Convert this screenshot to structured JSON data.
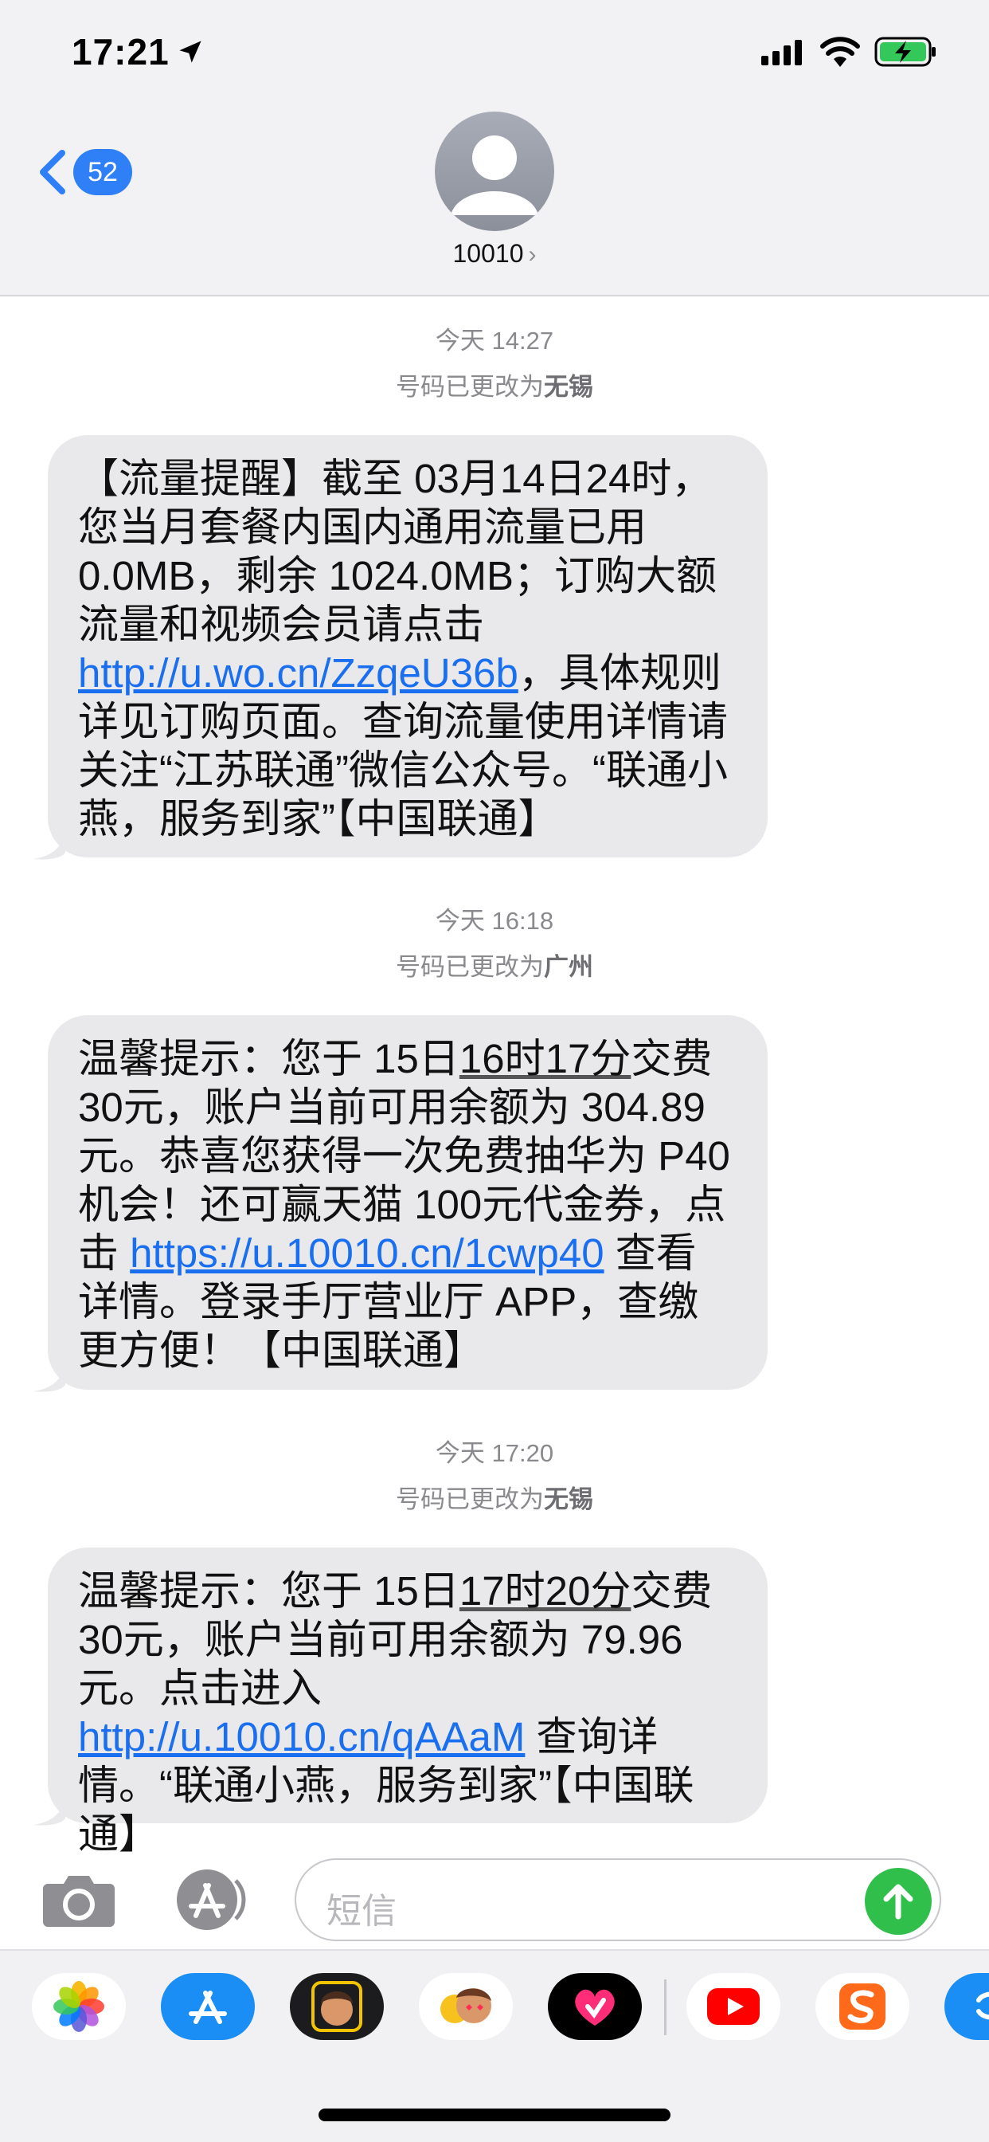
{
  "status_bar": {
    "time": "17:21"
  },
  "header": {
    "back_count": "52",
    "contact_name": "10010",
    "contact_chevron": "›"
  },
  "conversation": [
    {
      "timestamp": "今天 14:27",
      "notice_prefix": "号码已更改为",
      "notice_place": "无锡",
      "message": {
        "t1": "【流量提醒】截至 03月14日24时，您当月套餐内国内通用流量已用 0.0MB，剩余 1024.0MB；订购大额流量和视频会员请点击 ",
        "link": "http://u.wo.cn/ZzqeU36b",
        "t2": "，具体规则详见订购页面。查询流量使用详情请关注“江苏联通”微信公众号。“联通小燕，服务到家”【中国联通】"
      }
    },
    {
      "timestamp": "今天 16:18",
      "notice_prefix": "号码已更改为",
      "notice_place": "广州",
      "message": {
        "t1": "温馨提示：您于 15日",
        "t_ul": "16时17分",
        "t2": "交费 30元，账户当前可用余额为 304.89元。恭喜您获得一次免费抽华为 P40机会！还可赢天猫 100元代金券，点击 ",
        "link": "https://u.10010.cn/1cwp40",
        "t3": " 查看详情。登录手厅营业厅 APP，查缴更方便！【中国联通】"
      }
    },
    {
      "timestamp": "今天 17:20",
      "notice_prefix": "号码已更改为",
      "notice_place": "无锡",
      "message": {
        "t1": "温馨提示：您于 15日",
        "t_ul": "17时20分",
        "t2": "交费 30元，账户当前可用余额为 79.96元。点击进入 ",
        "link": "http://u.10010.cn/qAAaM",
        "t3": " 查询详情。“联通小燕，服务到家”【中国联通】"
      }
    }
  ],
  "composer": {
    "placeholder": "短信"
  },
  "colors": {
    "link": "#1a6ff0",
    "bubble": "#e9e9eb",
    "accent": "#2f7ff6",
    "send": "#2fbf4a"
  },
  "app_drawer": [
    "photos-icon",
    "app-store-icon",
    "memoji-icon",
    "animoji-icon",
    "digital-touch-icon",
    "youtube-icon",
    "sogou-icon",
    "extra-app-icon"
  ]
}
